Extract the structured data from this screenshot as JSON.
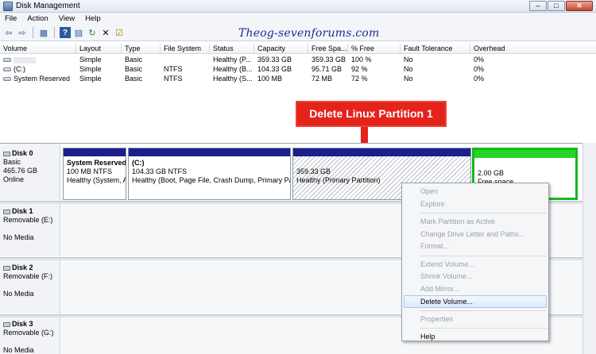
{
  "window": {
    "title": "Disk Management",
    "buttons": [
      "–",
      "□",
      "✕"
    ]
  },
  "menu": [
    "File",
    "Action",
    "View",
    "Help"
  ],
  "toolbar": {
    "icons": [
      "back-icon",
      "forward-icon",
      "show-hide-tree-icon",
      "help-icon",
      "properties-icon",
      "refresh-icon",
      "delete-icon",
      "check-icon"
    ]
  },
  "watermark": "Theog-sevenforums.com",
  "volume_table": {
    "headers": [
      "Volume",
      "Layout",
      "Type",
      "File System",
      "Status",
      "Capacity",
      "Free Spa...",
      "% Free",
      "Fault Tolerance",
      "Overhead"
    ],
    "rows": [
      [
        "",
        "Simple",
        "Basic",
        "",
        "Healthy (P...",
        "359.33 GB",
        "359.33 GB",
        "100 %",
        "No",
        "0%"
      ],
      [
        "(C:)",
        "Simple",
        "Basic",
        "NTFS",
        "Healthy (B...",
        "104.33 GB",
        "95.71 GB",
        "92 %",
        "No",
        "0%"
      ],
      [
        "System Reserved",
        "Simple",
        "Basic",
        "NTFS",
        "Healthy (S...",
        "100 MB",
        "72 MB",
        "72 %",
        "No",
        "0%"
      ]
    ]
  },
  "annotation": {
    "text": "Delete Linux Partition 1"
  },
  "disks": [
    {
      "name": "Disk 0",
      "lines": [
        "Basic",
        "465.76 GB",
        "Online"
      ],
      "partitions": [
        {
          "title": "System Reserved",
          "size": "100 MB NTFS",
          "status": "Healthy (System, A"
        },
        {
          "title": "(C:)",
          "size": "104.33 GB NTFS",
          "status": "Healthy (Boot, Page File, Crash Dump, Primary Part"
        },
        {
          "title": "",
          "size": "359.33 GB",
          "status": "Healthy (Primary Partition)"
        },
        {
          "title": "",
          "size": "2.00 GB",
          "status": "Free space"
        }
      ]
    },
    {
      "name": "Disk 1",
      "lines": [
        "Removable (E:)",
        "",
        "No Media"
      ]
    },
    {
      "name": "Disk 2",
      "lines": [
        "Removable (F:)",
        "",
        "No Media"
      ]
    },
    {
      "name": "Disk 3",
      "lines": [
        "Removable (G:)",
        "",
        "No Media"
      ]
    }
  ],
  "context_menu": {
    "items": [
      {
        "label": "Open",
        "enabled": false
      },
      {
        "label": "Explore",
        "enabled": false
      },
      {
        "sep": true
      },
      {
        "label": "Mark Partition as Active",
        "enabled": false
      },
      {
        "label": "Change Drive Letter and Paths...",
        "enabled": false
      },
      {
        "label": "Format...",
        "enabled": false
      },
      {
        "sep": true
      },
      {
        "label": "Extend Volume...",
        "enabled": false
      },
      {
        "label": "Shrink Volume...",
        "enabled": false
      },
      {
        "label": "Add Mirror...",
        "enabled": false
      },
      {
        "label": "Delete Volume...",
        "enabled": true,
        "hover": true
      },
      {
        "sep": true
      },
      {
        "label": "Properties",
        "enabled": false
      },
      {
        "sep": true
      },
      {
        "label": "Help",
        "enabled": true
      }
    ]
  }
}
